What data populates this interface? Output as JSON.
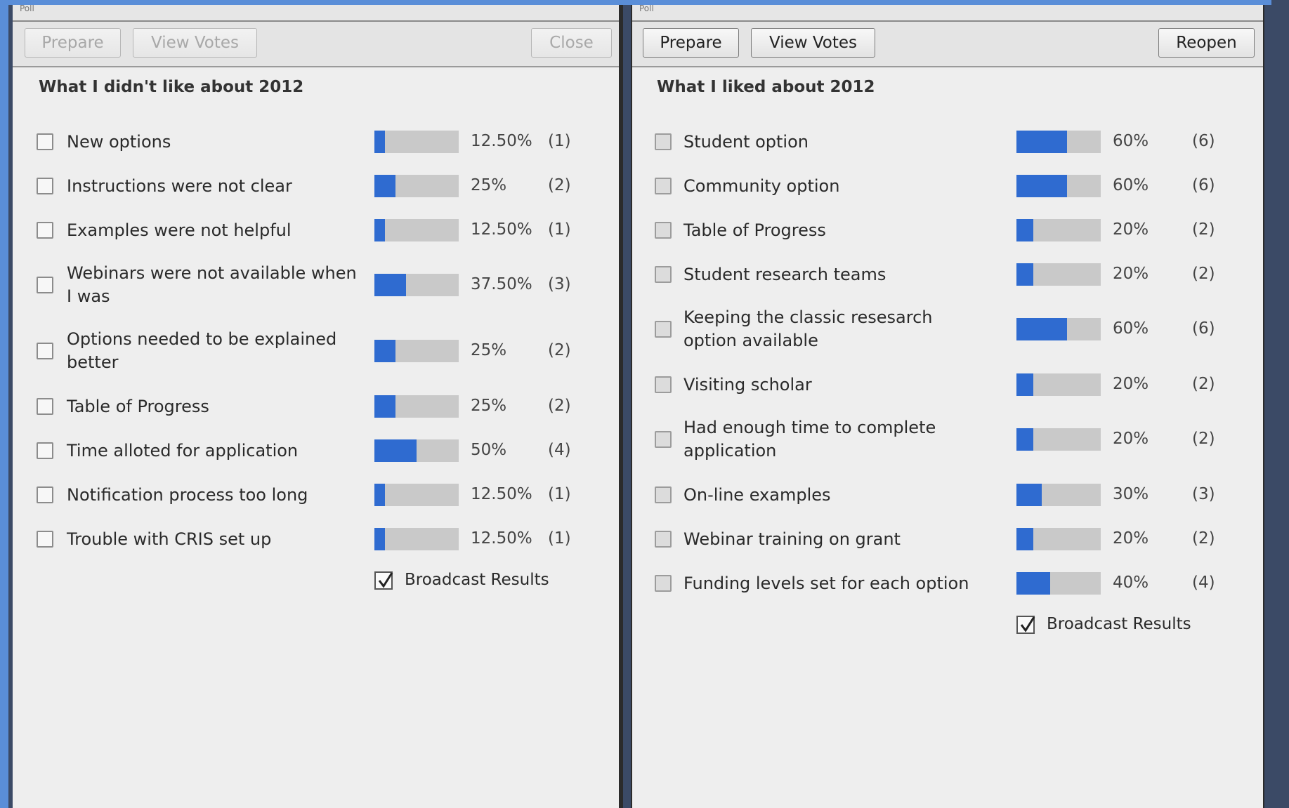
{
  "left_pod": {
    "title_fragment": "Poll",
    "buttons": {
      "prepare": "Prepare",
      "view_votes": "View Votes",
      "close": "Close"
    },
    "question": "What I didn't like about 2012",
    "answers": [
      {
        "label": "New options",
        "percent": "12.50%",
        "count": "(1)",
        "fraction": 0.125
      },
      {
        "label": "Instructions were not clear",
        "percent": "25%",
        "count": "(2)",
        "fraction": 0.25
      },
      {
        "label": "Examples were not helpful",
        "percent": "12.50%",
        "count": "(1)",
        "fraction": 0.125
      },
      {
        "label": "Webinars were not available when I was",
        "percent": "37.50%",
        "count": "(3)",
        "fraction": 0.375
      },
      {
        "label": "Options needed to be explained better",
        "percent": "25%",
        "count": "(2)",
        "fraction": 0.25
      },
      {
        "label": "Table of Progress",
        "percent": "25%",
        "count": "(2)",
        "fraction": 0.25
      },
      {
        "label": "Time alloted for application",
        "percent": "50%",
        "count": "(4)",
        "fraction": 0.5
      },
      {
        "label": "Notification process too long",
        "percent": "12.50%",
        "count": "(1)",
        "fraction": 0.125
      },
      {
        "label": "Trouble with CRIS set up",
        "percent": "12.50%",
        "count": "(1)",
        "fraction": 0.125
      }
    ],
    "broadcast_label": "Broadcast Results",
    "broadcast_checked": true
  },
  "right_pod": {
    "title_fragment": "Poll",
    "buttons": {
      "prepare": "Prepare",
      "view_votes": "View Votes",
      "reopen": "Reopen"
    },
    "question": "What I liked about 2012",
    "answers": [
      {
        "label": "Student option",
        "percent": "60%",
        "count": "(6)",
        "fraction": 0.6
      },
      {
        "label": "Community option",
        "percent": "60%",
        "count": "(6)",
        "fraction": 0.6
      },
      {
        "label": "Table of Progress",
        "percent": "20%",
        "count": "(2)",
        "fraction": 0.2
      },
      {
        "label": "Student research teams",
        "percent": "20%",
        "count": "(2)",
        "fraction": 0.2
      },
      {
        "label": "Keeping the classic resesarch option available",
        "percent": "60%",
        "count": "(6)",
        "fraction": 0.6
      },
      {
        "label": "Visiting scholar",
        "percent": "20%",
        "count": "(2)",
        "fraction": 0.2
      },
      {
        "label": "Had enough time to complete application",
        "percent": "20%",
        "count": "(2)",
        "fraction": 0.2
      },
      {
        "label": "On-line examples",
        "percent": "30%",
        "count": "(3)",
        "fraction": 0.3
      },
      {
        "label": "Webinar training on grant",
        "percent": "20%",
        "count": "(2)",
        "fraction": 0.2
      },
      {
        "label": "Funding levels set for each option",
        "percent": "40%",
        "count": "(4)",
        "fraction": 0.4
      }
    ],
    "broadcast_label": "Broadcast Results",
    "broadcast_checked": true
  },
  "colors": {
    "bar_fill": "#2f6bd0",
    "bar_track": "#c9c9c9",
    "pod_bg": "#eeeeee",
    "desktop": "#3b4a66",
    "accent_border": "#5a8ed8"
  },
  "icons": {
    "checkbox": "checkbox-icon",
    "checkmark": "checkmark-icon"
  }
}
